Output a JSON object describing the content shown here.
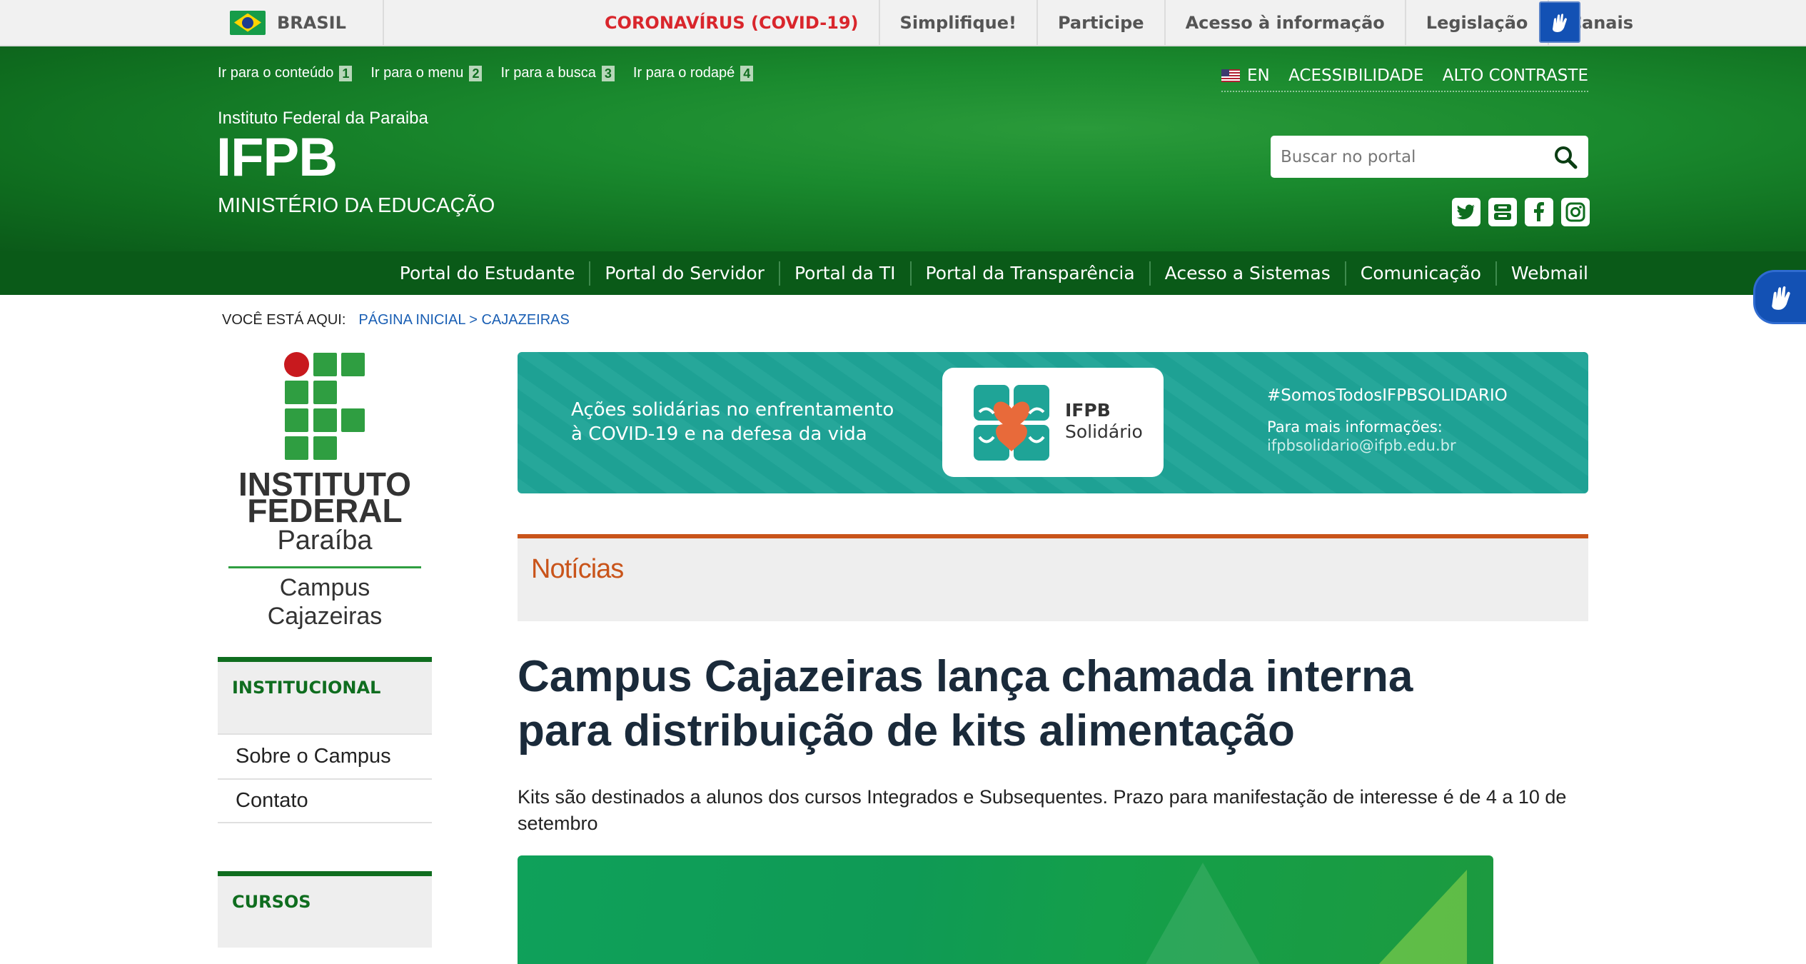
{
  "govbar": {
    "country": "BRASIL",
    "links": [
      "CORONAVÍRUS (COVID-19)",
      "Simplifique!",
      "Participe",
      "Acesso à informação",
      "Legislação",
      "Canais"
    ]
  },
  "accessibility_links": [
    {
      "label": "Ir para o conteúdo",
      "key": "1"
    },
    {
      "label": "Ir para o menu",
      "key": "2"
    },
    {
      "label": "Ir para a busca",
      "key": "3"
    },
    {
      "label": "Ir para o rodapé",
      "key": "4"
    }
  ],
  "top_links": {
    "language": "EN",
    "accessibility": "ACESSIBILIDADE",
    "contrast": "ALTO CONTRASTE"
  },
  "site": {
    "institution": "Instituto Federal da Paraiba",
    "acronym": "IFPB",
    "ministry": "MINISTÉRIO DA EDUCAÇÃO"
  },
  "search": {
    "placeholder": "Buscar no portal"
  },
  "social": [
    "twitter-icon",
    "youtube-icon",
    "facebook-icon",
    "instagram-icon"
  ],
  "main_nav": [
    "Portal do Estudante",
    "Portal do Servidor",
    "Portal da TI",
    "Portal da Transparência",
    "Acesso a Sistemas",
    "Comunicação",
    "Webmail"
  ],
  "breadcrumb": {
    "label": "VOCÊ ESTÁ AQUI:",
    "path": "PÁGINA INICIAL > CAJAZEIRAS"
  },
  "logo": {
    "line1": "INSTITUTO",
    "line2": "FEDERAL",
    "line3": "Paraíba",
    "campus_line1": "Campus",
    "campus_line2": "Cajazeiras"
  },
  "sidebar": {
    "institucional": {
      "title": "INSTITUCIONAL",
      "items": [
        "Sobre o Campus",
        "Contato"
      ]
    },
    "cursos": {
      "title": "CURSOS"
    }
  },
  "banner": {
    "left_line1": "Ações solidárias  no enfrentamento",
    "left_line2": "à COVID-19 e na defesa da vida",
    "card_name1": "IFPB",
    "card_name2": "Solidário",
    "hashtag": "#SomosTodosIFPBSOLIDARIO",
    "info": "Para mais informações:",
    "email": "ifpbsolidario@ifpb.edu.br",
    "color": "#1fa497"
  },
  "section_title": "Notícias",
  "article": {
    "title_line1": "Campus Cajazeiras lança chamada interna",
    "title_line2": "para distribuição de kits alimentação",
    "description": "Kits são destinados a alunos dos cursos Integrados e Subsequentes. Prazo para manifestação de interesse é de 4 a 10 de setembro"
  },
  "colors": {
    "primary_green": "#0f6d1f",
    "nav_green": "#0a5a18",
    "accent_orange": "#c9541a",
    "covid_red": "#d9262c",
    "gov_blue": "#1351b4"
  }
}
